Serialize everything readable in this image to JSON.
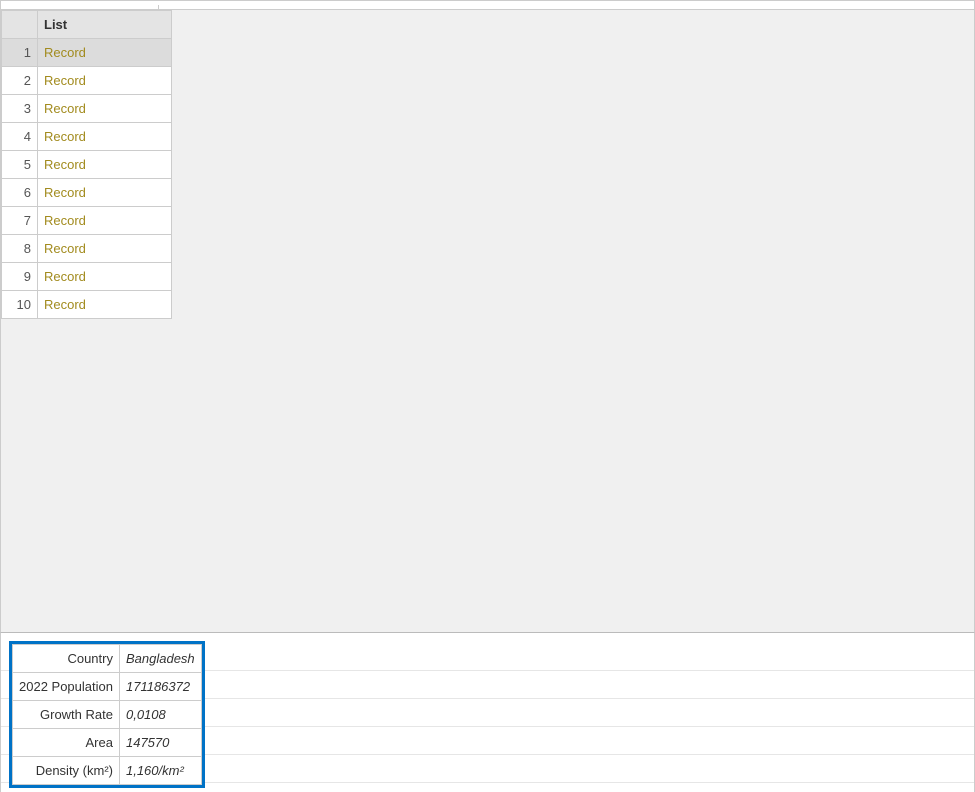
{
  "list": {
    "header": "List",
    "rows": [
      {
        "num": "1",
        "value": "Record",
        "selected": true
      },
      {
        "num": "2",
        "value": "Record",
        "selected": false
      },
      {
        "num": "3",
        "value": "Record",
        "selected": false
      },
      {
        "num": "4",
        "value": "Record",
        "selected": false
      },
      {
        "num": "5",
        "value": "Record",
        "selected": false
      },
      {
        "num": "6",
        "value": "Record",
        "selected": false
      },
      {
        "num": "7",
        "value": "Record",
        "selected": false
      },
      {
        "num": "8",
        "value": "Record",
        "selected": false
      },
      {
        "num": "9",
        "value": "Record",
        "selected": false
      },
      {
        "num": "10",
        "value": "Record",
        "selected": false
      }
    ]
  },
  "preview": {
    "fields": [
      {
        "label": "Country",
        "value": "Bangladesh"
      },
      {
        "label": "2022 Population",
        "value": "171186372"
      },
      {
        "label": "Growth Rate",
        "value": "0,0108"
      },
      {
        "label": "Area",
        "value": "147570"
      },
      {
        "label": "Density (km²)",
        "value": "1,160/km²"
      }
    ]
  }
}
